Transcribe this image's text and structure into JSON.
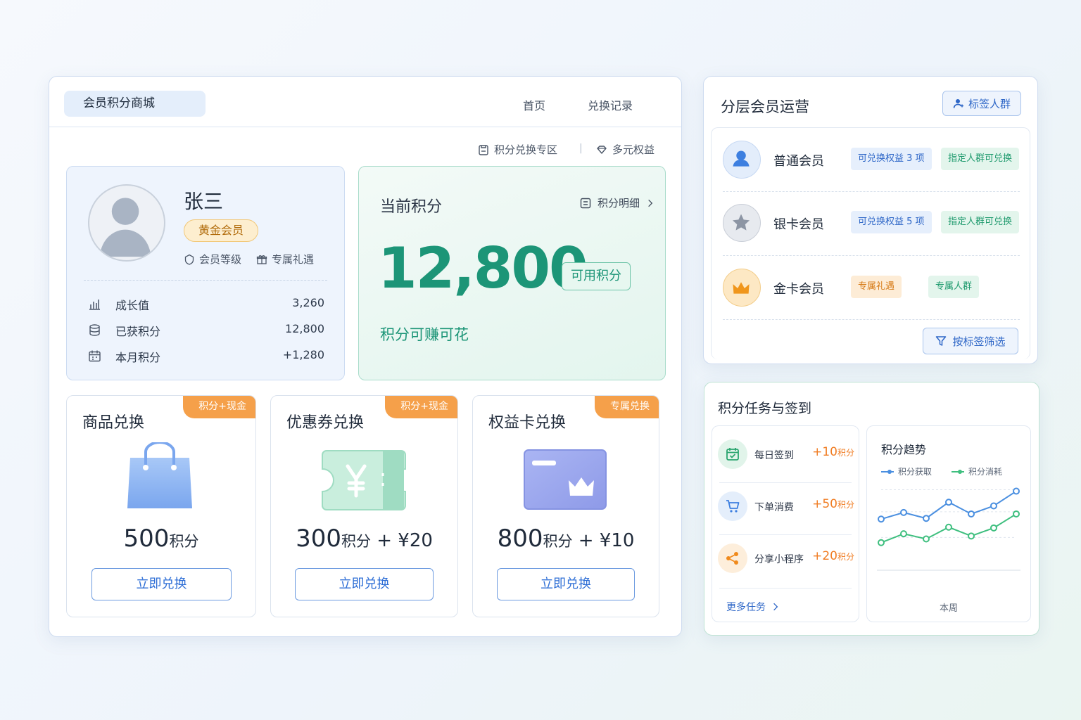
{
  "header": {
    "brand": "会员积分商城",
    "nav": [
      "首页",
      "兑换记录"
    ],
    "subnav": [
      "积分兑换专区",
      "多元权益"
    ],
    "separator": "|"
  },
  "profile": {
    "name": "张三",
    "badge": "黄金会员",
    "links": [
      "会员等级",
      "专属礼遇"
    ],
    "stats": [
      {
        "label": "成长值",
        "value": "3,260",
        "icon": "bar-chart-icon"
      },
      {
        "label": "已获积分",
        "value": "12,800",
        "icon": "coins-icon"
      },
      {
        "label": "本月积分",
        "value": "+1,280",
        "icon": "calendar-icon"
      }
    ]
  },
  "points": {
    "title": "当前积分",
    "detail_link": "积分明细",
    "value": "12,800",
    "available_label": "可用积分",
    "subtitle": "积分可赚可花"
  },
  "exchange": [
    {
      "title": "商品兑换",
      "tag": "积分+现金",
      "num": "500",
      "unit": "积分",
      "extra": "",
      "button": "立即兑换",
      "icon": "shopping-bag-icon"
    },
    {
      "title": "优惠券兑换",
      "tag": "积分+现金",
      "num": "300",
      "unit": "积分",
      "extra": " + ¥20",
      "button": "立即兑换",
      "icon": "coupon-icon"
    },
    {
      "title": "权益卡兑换",
      "tag": "专属兑换",
      "num": "800",
      "unit": "积分",
      "extra": " + ¥10",
      "button": "立即兑换",
      "icon": "benefit-card-icon"
    }
  ],
  "tiers": {
    "title": "分层会员运营",
    "tag_button": "标签人群",
    "filter_button": "按标签筛选",
    "rows": [
      {
        "name": "普通会员",
        "pills": [
          "可兑换权益 3 项",
          "指定人群可兑换"
        ]
      },
      {
        "name": "银卡会员",
        "pills": [
          "可兑换权益 5 项",
          "指定人群可兑换"
        ]
      },
      {
        "name": "金卡会员",
        "pills": [
          "专属礼遇",
          "专属人群"
        ]
      }
    ]
  },
  "tasks": {
    "title": "积分任务与签到",
    "items": [
      {
        "name": "每日签到",
        "points": "+10",
        "unit": "积分"
      },
      {
        "name": "下单消费",
        "points": "+50",
        "unit": "积分"
      },
      {
        "name": "分享小程序",
        "points": "+20",
        "unit": "积分"
      }
    ],
    "more": "更多任务"
  },
  "colors": {
    "primary": "#2f6fd6",
    "points_green": "#1c9577",
    "tag_orange": "#f5a04a",
    "earn_line": "#4a8fe0",
    "spend_line": "#3fbf7f"
  },
  "chart_data": {
    "type": "line",
    "title": "积分趋势",
    "xlabel": "本周",
    "ylabel": "",
    "x": [
      1,
      2,
      3,
      4,
      5,
      6,
      7,
      8
    ],
    "series": [
      {
        "name": "积分获取",
        "values": [
          60,
          69,
          61,
          83,
          67,
          78,
          98,
          null
        ]
      },
      {
        "name": "积分消耗",
        "values": [
          28,
          40,
          33,
          49,
          37,
          48,
          67,
          null
        ]
      }
    ],
    "grid": true,
    "legend": "top"
  }
}
